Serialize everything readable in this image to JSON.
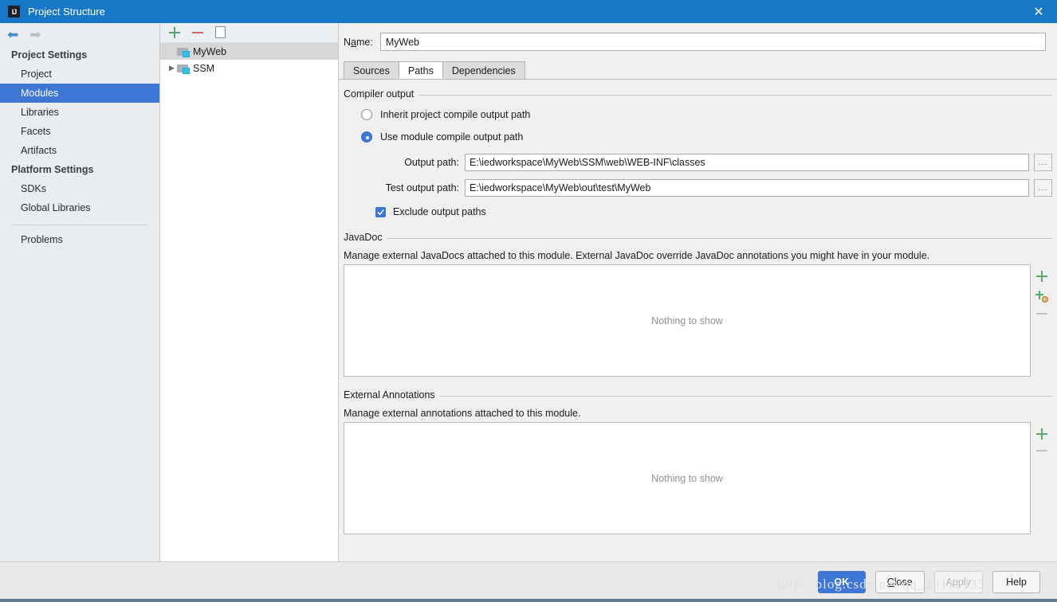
{
  "window": {
    "title": "Project Structure",
    "logo_icon": "intellij-idea-logo",
    "close_icon": "close-icon"
  },
  "nav": {
    "back_icon": "arrow-left-icon",
    "forward_icon": "arrow-right-icon"
  },
  "sidebar": {
    "groups": [
      {
        "title": "Project Settings",
        "items": [
          {
            "label": "Project",
            "selected": false
          },
          {
            "label": "Modules",
            "selected": true
          },
          {
            "label": "Libraries",
            "selected": false
          },
          {
            "label": "Facets",
            "selected": false
          },
          {
            "label": "Artifacts",
            "selected": false
          }
        ]
      },
      {
        "title": "Platform Settings",
        "items": [
          {
            "label": "SDKs",
            "selected": false
          },
          {
            "label": "Global Libraries",
            "selected": false
          }
        ]
      }
    ],
    "extra": [
      {
        "label": "Problems",
        "selected": false
      }
    ]
  },
  "tree": {
    "toolbar": [
      {
        "icon": "plus-icon",
        "title": "Add"
      },
      {
        "icon": "minus-icon",
        "title": "Remove"
      },
      {
        "icon": "copy-icon",
        "title": "Copy"
      }
    ],
    "nodes": [
      {
        "label": "MyWeb",
        "selected": true,
        "expandable": false,
        "icon": "module-icon"
      },
      {
        "label": "SSM",
        "selected": false,
        "expandable": true,
        "icon": "module-icon"
      }
    ]
  },
  "editor": {
    "name_label_pre": "N",
    "name_label_mnemonic": "a",
    "name_label_post": "me:",
    "name_value": "MyWeb",
    "tabs": [
      {
        "label": "Sources",
        "active": false
      },
      {
        "label": "Paths",
        "active": true
      },
      {
        "label": "Dependencies",
        "active": false
      }
    ],
    "compiler_output": {
      "group_title": "Compiler output",
      "radio_inherit": "Inherit project compile output path",
      "radio_module": "Use module compile output path",
      "selected": "module",
      "output_path_label": "Output path:",
      "output_path_value": "E:\\iedworkspace\\MyWeb\\SSM\\web\\WEB-INF\\classes",
      "test_output_path_label": "Test output path:",
      "test_output_path_value": "E:\\iedworkspace\\MyWeb\\out\\test\\MyWeb",
      "browse_label": "...",
      "exclude_checkbox_label": "Exclude output paths",
      "exclude_checked": true
    },
    "javadoc": {
      "group_title": "JavaDoc",
      "description": "Manage external JavaDocs attached to this module. External JavaDoc override JavaDoc annotations you might have in your module.",
      "empty_text": "Nothing to show",
      "actions": [
        {
          "icon": "plus-icon",
          "enabled": true
        },
        {
          "icon": "plus-globe-icon",
          "enabled": true
        },
        {
          "icon": "minus-icon",
          "enabled": false
        }
      ]
    },
    "annotations": {
      "group_title": "External Annotations",
      "description": "Manage external annotations attached to this module.",
      "empty_text": "Nothing to show",
      "actions": [
        {
          "icon": "plus-icon",
          "enabled": true
        },
        {
          "icon": "minus-icon",
          "enabled": false
        }
      ]
    }
  },
  "footer": {
    "buttons": [
      {
        "label": "OK",
        "style": "primary",
        "mnemonic": ""
      },
      {
        "label": "Close",
        "style": "normal",
        "mnemonic": "C"
      },
      {
        "label": "Apply",
        "style": "disabled",
        "mnemonic": ""
      },
      {
        "label": "Help",
        "style": "normal",
        "mnemonic": ""
      }
    ],
    "watermark": "http://blog.csdn.net/qq_28115333"
  },
  "colors": {
    "titlebar": "#1878c8",
    "accent": "#3d76d4",
    "panel": "#f0f0f0",
    "sidebar": "#e9edf0"
  }
}
